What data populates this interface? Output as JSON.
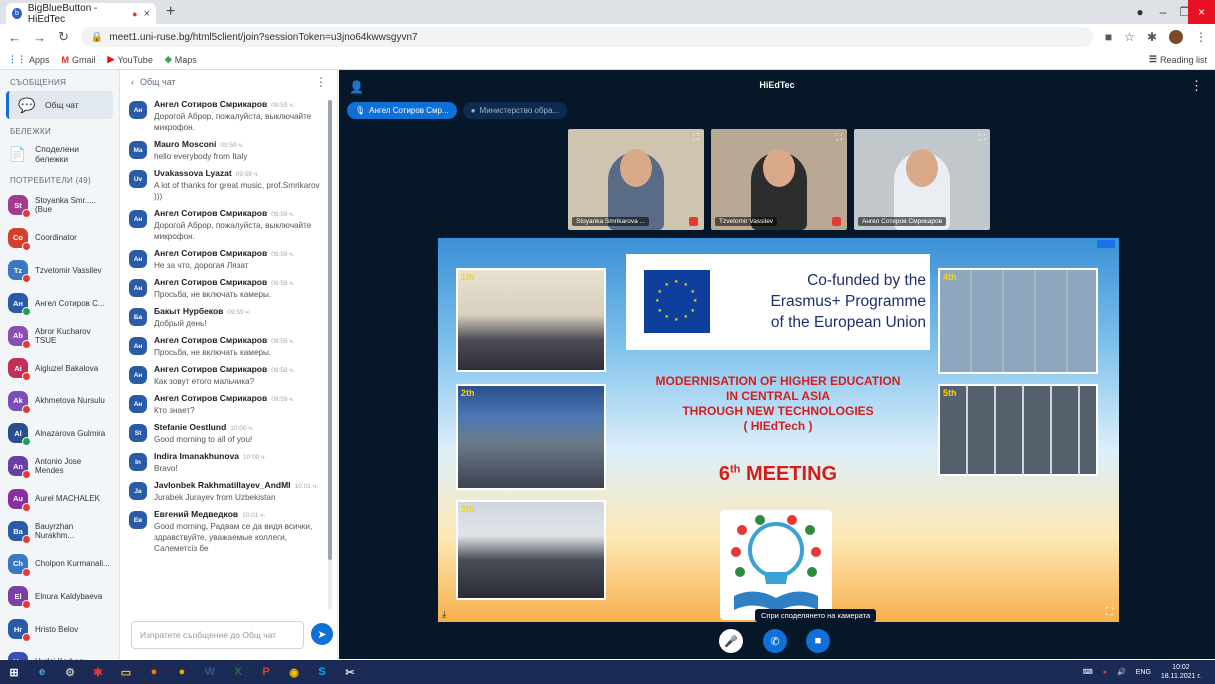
{
  "browser": {
    "tab_title": "BigBlueButton - HiEdTec",
    "url": "meet1.uni-ruse.bg/html5client/join?sessionToken=u3jno64kwwsgyvn7",
    "bookmarks": [
      "Apps",
      "Gmail",
      "YouTube",
      "Maps"
    ],
    "reading_list": "Reading list"
  },
  "nav": {
    "messages_title": "СЪОБЩЕНИЯ",
    "public_chat": "Общ чат",
    "notes_title": "БЕЛЕЖКИ",
    "shared_notes": "Споделени бележки",
    "users_title": "ПОТРЕБИТЕЛИ (49)",
    "users": [
      {
        "initials": "St",
        "name": "Stoyanka Smr.....(Bue",
        "color": "#a23c8f"
      },
      {
        "initials": "Co",
        "name": "Coordinator",
        "color": "#d33f2a"
      },
      {
        "initials": "Tz",
        "name": "Tzvetomir Vassilev",
        "color": "#3a78c2"
      },
      {
        "initials": "Ан",
        "name": "Ангел Сотиров С...",
        "color": "#2a5ba8"
      },
      {
        "initials": "Ab",
        "name": "Abror Kucharov TSUE",
        "color": "#8a4fb5"
      },
      {
        "initials": "Ai",
        "name": "Aigluzel Bakalova",
        "color": "#c2305a"
      },
      {
        "initials": "Ak",
        "name": "Akhmetova Nursulu",
        "color": "#7b4fb5"
      },
      {
        "initials": "Al",
        "name": "Alnazarova Gulmira",
        "color": "#2a4e8f"
      },
      {
        "initials": "An",
        "name": "Antonio Jose Mendes",
        "color": "#6a3fa5"
      },
      {
        "initials": "Au",
        "name": "Aurel MACHALEK",
        "color": "#8a2f9f"
      },
      {
        "initials": "Ba",
        "name": "Bauyrzhan Nurakhm...",
        "color": "#2a5ba8"
      },
      {
        "initials": "Ch",
        "name": "Cholpon Kurmanali...",
        "color": "#3a78c2"
      },
      {
        "initials": "El",
        "name": "Elnura Kaldybaeva",
        "color": "#7b3fa5"
      },
      {
        "initials": "Hr",
        "name": "Hristo Belov",
        "color": "#2a5ba8"
      },
      {
        "initials": "Hy",
        "name": "Hydai Kadyrov",
        "color": "#3a4fb5"
      }
    ]
  },
  "chat": {
    "header": "Общ чат",
    "input_placeholder": "Изпратете съобщение до Общ чат",
    "messages": [
      {
        "initials": "Ан",
        "name": "Ангел Сотиров Смрикаров",
        "time": "09:59 ч.",
        "text": "Дорогой Аброр, пожалуйста, выключайте микрофон."
      },
      {
        "initials": "Ma",
        "name": "Mauro Mosconi",
        "time": "09:59 ч.",
        "text": "hello everybody from Italy"
      },
      {
        "initials": "Uv",
        "name": "Uvakassova Lyazat",
        "time": "09:59 ч.",
        "text": "A lot of thanks for great music, prof.Smrikarov )))"
      },
      {
        "initials": "Ан",
        "name": "Ангел Сотиров Смрикаров",
        "time": "09:59 ч.",
        "text": "Дорогой Аброр, пожалуйста, выключайте микрофон."
      },
      {
        "initials": "Ан",
        "name": "Ангел Сотиров Смрикаров",
        "time": "09:59 ч.",
        "text": "Не за что, дорогая Лязат"
      },
      {
        "initials": "Ан",
        "name": "Ангел Сотиров Смрикаров",
        "time": "09:59 ч.",
        "text": "Просьба, не включать камеры."
      },
      {
        "initials": "Ба",
        "name": "Бакыт Нурбеков",
        "time": "09:59 ч.",
        "text": "Добрый день!"
      },
      {
        "initials": "Ан",
        "name": "Ангел Сотиров Смрикаров",
        "time": "09:59 ч.",
        "text": "Просьба, не включать камеры."
      },
      {
        "initials": "Ан",
        "name": "Ангел Сотиров Смрикаров",
        "time": "09:59 ч.",
        "text": "Как зовут етого мальчика?"
      },
      {
        "initials": "Ан",
        "name": "Ангел Сотиров Смрикаров",
        "time": "09:59 ч.",
        "text": "Кто знает?"
      },
      {
        "initials": "St",
        "name": "Stefanie Oestlund",
        "time": "10:00 ч.",
        "text": "Good morning to all of you!"
      },
      {
        "initials": "In",
        "name": "Indira Imanakhunova",
        "time": "10:00 ч.",
        "text": "Bravo!"
      },
      {
        "initials": "Ja",
        "name": "Javlonbek Rakhmatillayev_AndMI",
        "time": "10:01 ч.",
        "text": "Jurabek Jurayev from Uzbekistan"
      },
      {
        "initials": "Ев",
        "name": "Евгений Медведков",
        "time": "10:01 ч.",
        "text": "Good morning, Радвам се да видя всички, здравствуйте, уважаемые коллеги, Салеметсіз бе"
      }
    ]
  },
  "main": {
    "title": "HiEdTec",
    "talkers": [
      "Ангел Сотиров Смр...",
      "Министерство обра..."
    ],
    "videos": [
      {
        "name": "Stoyanka Smrikarova ...",
        "bg": "#cfc4b0",
        "shirt": "#5a6b86"
      },
      {
        "name": "Tzvetomir Vassilev",
        "bg": "#b9a894",
        "shirt": "#2d2d2d"
      },
      {
        "name": "Ангел Сотиров Смрикаров",
        "bg": "#c2c7cc",
        "shirt": "#e9eef3"
      }
    ],
    "tooltip": "Спри споделянето на камерата"
  },
  "slide": {
    "eu_text": [
      "Co-funded by the",
      "Erasmus+ Programme",
      "of the European Union"
    ],
    "title_lines": [
      "MODERNISATION OF HIGHER EDUCATION",
      "IN CENTRAL ASIA",
      "THROUGH NEW TECHNOLOGIES",
      "( HIEdTech )"
    ],
    "meeting": "6",
    "meeting_suffix": "th",
    "meeting_word": "MEETING",
    "photo_labels": [
      "1th",
      "2th",
      "3th",
      "4th",
      "5th"
    ]
  },
  "taskbar": {
    "lang": "ENG",
    "time": "10:02",
    "date": "18.11.2021 г."
  }
}
